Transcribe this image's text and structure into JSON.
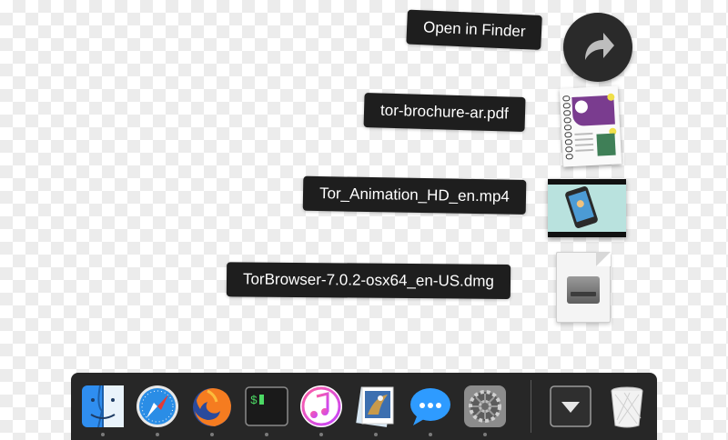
{
  "stack": {
    "open_in_finder_label": "Open in Finder",
    "items": [
      {
        "label": "tor-brochure-ar.pdf",
        "icon": "pdf-document-icon"
      },
      {
        "label": "Tor_Animation_HD_en.mp4",
        "icon": "video-file-icon"
      },
      {
        "label": "TorBrowser-7.0.2-osx64_en-US.dmg",
        "icon": "disk-image-icon"
      }
    ]
  },
  "dock": {
    "apps": [
      {
        "name": "finder-icon",
        "running": true
      },
      {
        "name": "safari-icon",
        "running": true
      },
      {
        "name": "firefox-icon",
        "running": true
      },
      {
        "name": "terminal-icon",
        "running": true,
        "text": "$"
      },
      {
        "name": "itunes-icon",
        "running": true
      },
      {
        "name": "preview-icon",
        "running": true
      },
      {
        "name": "messages-icon",
        "running": true
      },
      {
        "name": "system-preferences-icon",
        "running": true
      }
    ],
    "stack_toggle": {
      "name": "downloads-stack-icon"
    },
    "trash": {
      "name": "trash-icon"
    }
  },
  "colors": {
    "label_bg": "#1e1e1e",
    "dock_bg": "#272727",
    "accent_blue": "#1e88e5"
  }
}
